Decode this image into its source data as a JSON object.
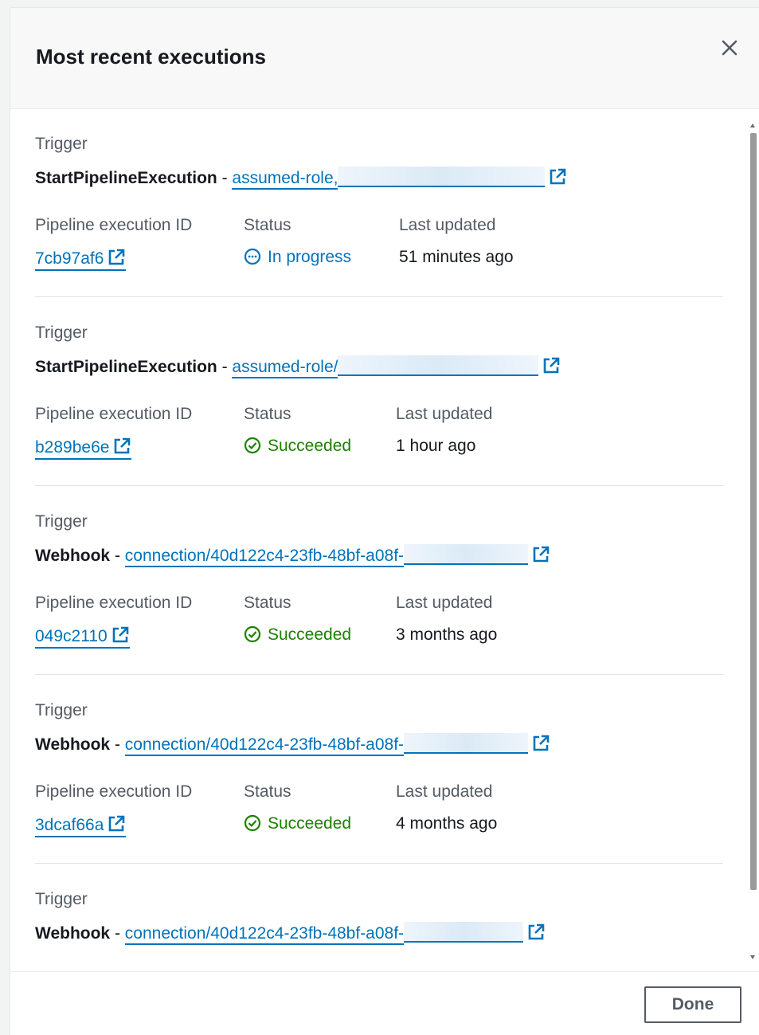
{
  "modal": {
    "title": "Most recent executions",
    "done_label": "Done"
  },
  "labels": {
    "trigger": "Trigger",
    "execution_id": "Pipeline execution ID",
    "status": "Status",
    "last_updated": "Last updated"
  },
  "executions": [
    {
      "trigger_type": "StartPipelineExecution",
      "trigger_sep": " - ",
      "trigger_source": "assumed-role,",
      "execution_id": "7cb97af6",
      "status": "In progress",
      "status_kind": "in-progress",
      "last_updated": "51 minutes ago"
    },
    {
      "trigger_type": "StartPipelineExecution",
      "trigger_sep": " - ",
      "trigger_source": "assumed-role/",
      "execution_id": "b289be6e",
      "status": "Succeeded",
      "status_kind": "success",
      "last_updated": "1 hour ago"
    },
    {
      "trigger_type": "Webhook",
      "trigger_sep": " - ",
      "trigger_source": "connection/40d122c4-23fb-48bf-a08f-",
      "execution_id": "049c2110",
      "status": "Succeeded",
      "status_kind": "success",
      "last_updated": "3 months ago"
    },
    {
      "trigger_type": "Webhook",
      "trigger_sep": " - ",
      "trigger_source": "connection/40d122c4-23fb-48bf-a08f-",
      "execution_id": "3dcaf66a",
      "status": "Succeeded",
      "status_kind": "success",
      "last_updated": "4 months ago"
    },
    {
      "trigger_type": "Webhook",
      "trigger_sep": " - ",
      "trigger_source": "connection/40d122c4-23fb-48bf-a08f-"
    }
  ],
  "colors": {
    "link": "#0073bb",
    "success": "#1d8102",
    "text": "#16191f",
    "label": "#545b64"
  }
}
